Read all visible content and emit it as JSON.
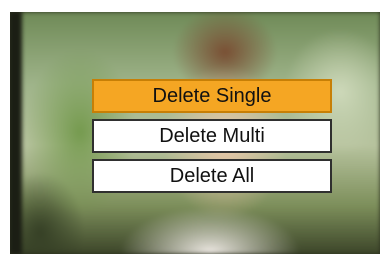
{
  "menu": {
    "items": [
      {
        "label": "Delete Single",
        "selected": true
      },
      {
        "label": "Delete Multi",
        "selected": false
      },
      {
        "label": "Delete All",
        "selected": false
      }
    ]
  },
  "colors": {
    "selected_bg": "#f5a623",
    "item_bg": "#ffffff",
    "border": "#2f2f2f"
  }
}
